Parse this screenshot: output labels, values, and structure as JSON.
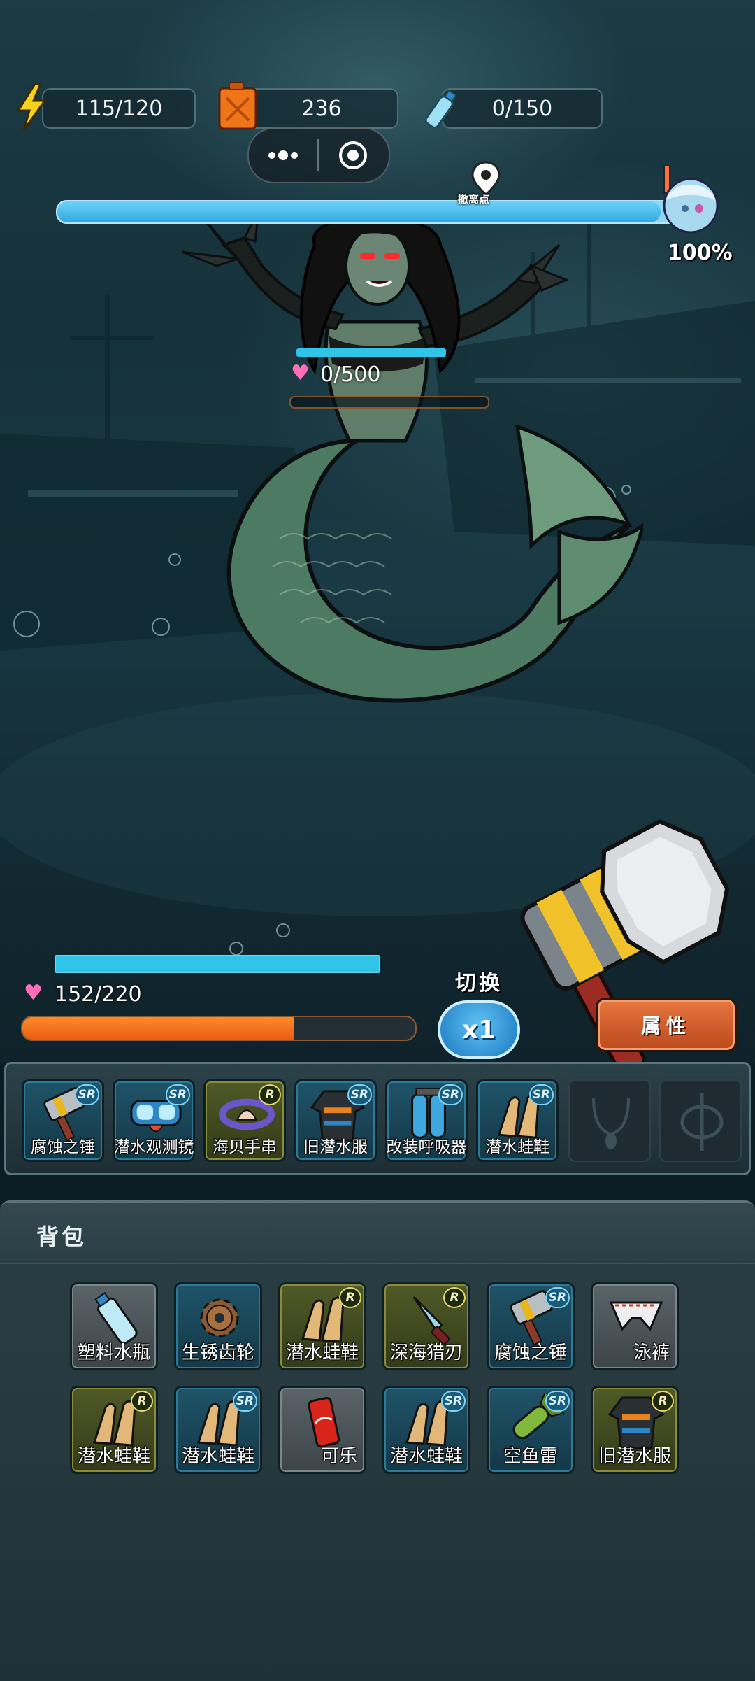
{
  "resources": {
    "energy": "115/120",
    "fuel": "236",
    "water": "0/150"
  },
  "progress": {
    "marker_label": "撤离点",
    "percent_text": "100%",
    "fraction": 0.97
  },
  "enemy": {
    "hp_text": "0/500",
    "hp_fraction": 0
  },
  "player": {
    "hp_text": "152/220",
    "hp_fraction": 0.69
  },
  "controls": {
    "switch_label": "切换",
    "multiplier": "x1",
    "attributes_label": "属性"
  },
  "equipment": [
    {
      "name": "腐蚀之锤",
      "rarity": "SR",
      "icon": "hammer-icon"
    },
    {
      "name": "潜水观测镜",
      "rarity": "SR",
      "icon": "diving-mask-icon"
    },
    {
      "name": "海贝手串",
      "rarity": "R",
      "icon": "shell-bracelet-icon"
    },
    {
      "name": "旧潜水服",
      "rarity": "SR",
      "icon": "wetsuit-icon"
    },
    {
      "name": "改装呼吸器",
      "rarity": "SR",
      "icon": "air-tank-icon"
    },
    {
      "name": "潜水蛙鞋",
      "rarity": "SR",
      "icon": "flippers-icon"
    }
  ],
  "empty_slots": [
    "necklace-slot-icon",
    "phi-slot-icon"
  ],
  "backpack": {
    "title": "背包",
    "items": [
      {
        "name": "塑料水瓶",
        "rarity": "",
        "icon": "water-bottle-icon"
      },
      {
        "name": "生锈齿轮",
        "rarity": "",
        "icon": "gear-icon"
      },
      {
        "name": "潜水蛙鞋",
        "rarity": "R",
        "icon": "flippers-icon"
      },
      {
        "name": "深海猎刃",
        "rarity": "R",
        "icon": "knife-icon"
      },
      {
        "name": "腐蚀之锤",
        "rarity": "SR",
        "icon": "hammer-icon"
      },
      {
        "name": "泳裤",
        "rarity": "",
        "icon": "swim-trunks-icon"
      },
      {
        "name": "潜水蛙鞋",
        "rarity": "R",
        "icon": "flippers-icon"
      },
      {
        "name": "潜水蛙鞋",
        "rarity": "SR",
        "icon": "flippers-icon"
      },
      {
        "name": "可乐",
        "rarity": "",
        "icon": "cola-can-icon"
      },
      {
        "name": "潜水蛙鞋",
        "rarity": "SR",
        "icon": "flippers-icon"
      },
      {
        "name": "空鱼雷",
        "rarity": "SR",
        "icon": "torpedo-icon"
      },
      {
        "name": "旧潜水服",
        "rarity": "R",
        "icon": "wetsuit-icon"
      }
    ]
  }
}
